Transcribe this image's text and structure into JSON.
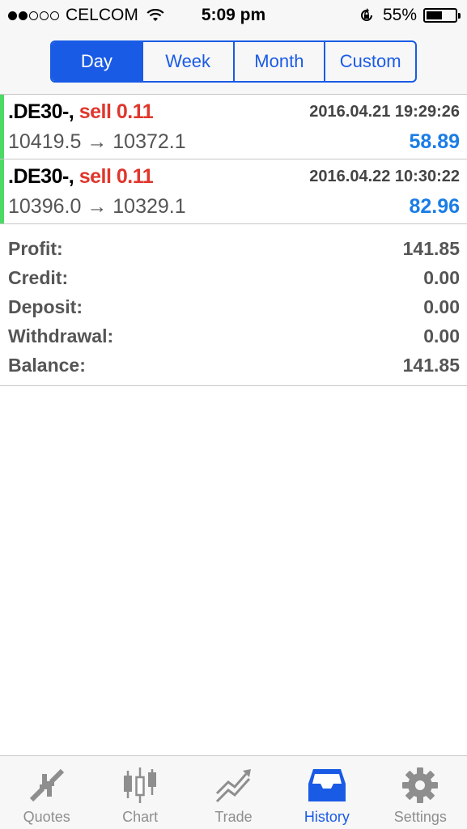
{
  "status": {
    "carrier": "CELCOM",
    "time": "5:09 pm",
    "battery": "55%",
    "battery_level": 0.55,
    "signal_bars": 2,
    "signal_total": 5
  },
  "periods": [
    {
      "label": "Day",
      "active": true
    },
    {
      "label": "Week",
      "active": false
    },
    {
      "label": "Month",
      "active": false
    },
    {
      "label": "Custom",
      "active": false
    }
  ],
  "deals": [
    {
      "symbol": ".DE30-,",
      "side": "sell 0.11",
      "time": "2016.04.21 19:29:26",
      "prices": "10419.5 → 10372.1",
      "profit": "58.89"
    },
    {
      "symbol": ".DE30-,",
      "side": "sell 0.11",
      "time": "2016.04.22 10:30:22",
      "prices": "10396.0 → 10329.1",
      "profit": "82.96"
    }
  ],
  "summary": [
    {
      "label": "Profit:",
      "value": "141.85"
    },
    {
      "label": "Credit:",
      "value": "0.00"
    },
    {
      "label": "Deposit:",
      "value": "0.00"
    },
    {
      "label": "Withdrawal:",
      "value": "0.00"
    },
    {
      "label": "Balance:",
      "value": "141.85"
    }
  ],
  "tabs": [
    {
      "label": "Quotes",
      "icon": "quotes-icon",
      "active": false
    },
    {
      "label": "Chart",
      "icon": "candlestick-icon",
      "active": false
    },
    {
      "label": "Trade",
      "icon": "trade-icon",
      "active": false
    },
    {
      "label": "History",
      "icon": "inbox-icon",
      "active": true
    },
    {
      "label": "Settings",
      "icon": "gear-icon",
      "active": false
    }
  ],
  "colors": {
    "accent": "#1a5be6",
    "sell": "#e0362c",
    "profit": "#1a7de6",
    "deal_bar": "#4cd964"
  }
}
